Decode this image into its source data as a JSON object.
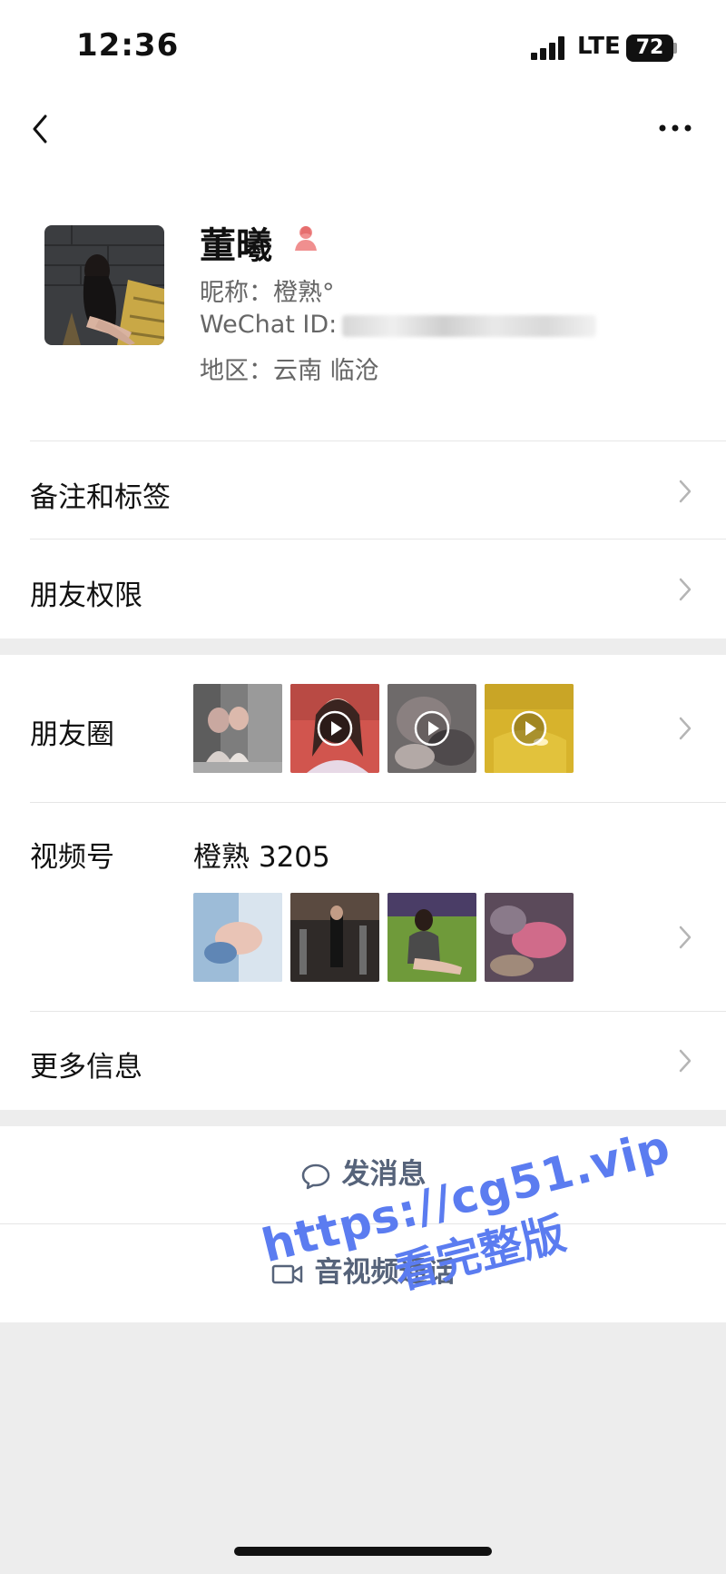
{
  "status_bar": {
    "time": "12:36",
    "network": "LTE",
    "battery": "72"
  },
  "profile": {
    "name": "董曦",
    "nickname": "昵称：橙熟°",
    "wechat_id_label": "WeChat ID:",
    "region": "地区：云南 临沧"
  },
  "menu": {
    "remarks_tags": "备注和标签",
    "friend_permissions": "朋友权限",
    "moments": "朋友圈",
    "channels": "视频号",
    "channels_name": "橙熟 3205",
    "more_info": "更多信息"
  },
  "actions": {
    "send_message": "发消息",
    "video_call": "音视频通话"
  },
  "watermark": {
    "line1": "https://cg51.vip",
    "line2": "看完整版"
  },
  "colors": {
    "action_text": "#56637a",
    "watermark": "#5b7cf0",
    "band": "#ededed"
  },
  "icons": [
    "back-icon",
    "more-icon",
    "female-icon",
    "play-icon",
    "chevron-right-icon",
    "message-bubble-icon",
    "video-camera-icon"
  ]
}
